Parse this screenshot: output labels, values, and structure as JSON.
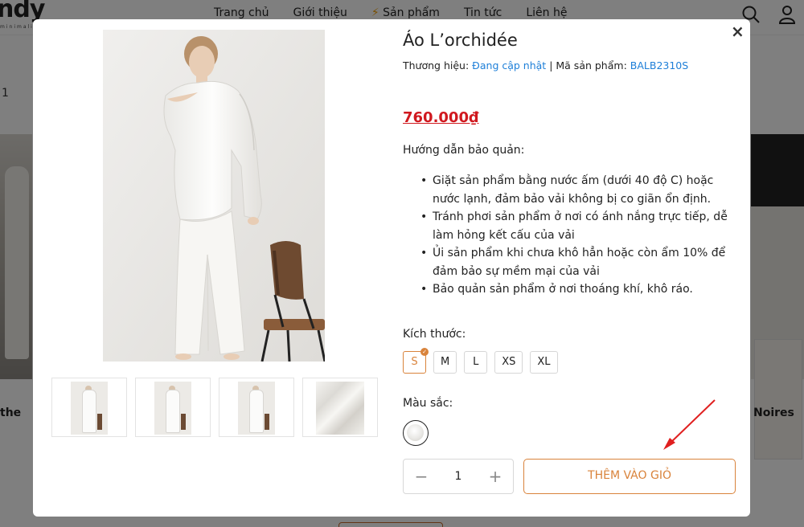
{
  "header": {
    "logo": "ndy",
    "logo_sub": "minimalis",
    "nav": [
      "Trang chủ",
      "Giới thiệu",
      "Sản phẩm",
      "Tin tức",
      "Liên hệ"
    ]
  },
  "background": {
    "crumb": "1",
    "left_product": "the",
    "right_product": "Noires"
  },
  "product": {
    "title": "Áo L’orchidée",
    "brand_label": "Thương hiệu:",
    "brand_value": "Đang cập nhật",
    "separator": "|",
    "sku_label": "Mã sản phẩm:",
    "sku_value": "BALB2310S",
    "price": "760.000₫",
    "care_title": "Hướng dẫn bảo quản:",
    "care_items": [
      "Giặt sản phẩm bằng nước ấm (dưới 40 độ C) hoặc nước lạnh, đảm bảo vải không bị co giãn ổn định.",
      "Tránh phơi sản phẩm ở nơi có ánh nắng trực tiếp, dễ làm hỏng kết cấu của vải",
      " Ủi sản phẩm khi chưa khô hẳn hoặc còn ẩm 10% để đảm bảo sự mềm mại của vải",
      "Bảo quản sản phẩm ở nơi thoáng khí, khô ráo."
    ],
    "size_label": "Kích thước:",
    "sizes": [
      "S",
      "M",
      "L",
      "XS",
      "XL"
    ],
    "selected_size": "S",
    "color_label": "Màu sắc:",
    "quantity": "1",
    "add_to_cart": "THÊM VÀO GIỎ",
    "close": "×",
    "minus": "−",
    "plus": "+"
  },
  "colors": {
    "accent": "#d9833b",
    "price": "#d0191f",
    "link": "#1e7fd8",
    "arrow": "#e01f1f"
  }
}
